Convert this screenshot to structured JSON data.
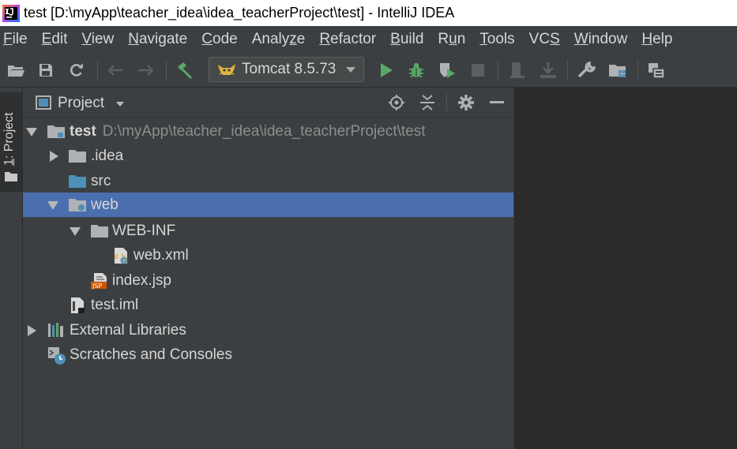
{
  "window": {
    "title": "test [D:\\myApp\\teacher_idea\\idea_teacherProject\\test] - IntelliJ IDEA"
  },
  "menu": [
    {
      "m": "F",
      "rest": "ile"
    },
    {
      "m": "E",
      "rest": "dit"
    },
    {
      "m": "V",
      "rest": "iew"
    },
    {
      "m": "N",
      "rest": "avigate"
    },
    {
      "m": "C",
      "rest": "ode"
    },
    {
      "pre": "Analy",
      "m": "z",
      "rest": "e"
    },
    {
      "m": "R",
      "rest": "efactor"
    },
    {
      "m": "B",
      "rest": "uild"
    },
    {
      "pre": "R",
      "m": "u",
      "rest": "n"
    },
    {
      "m": "T",
      "rest": "ools"
    },
    {
      "pre": "VC",
      "m": "S",
      "rest": ""
    },
    {
      "m": "W",
      "rest": "indow"
    },
    {
      "m": "H",
      "rest": "elp"
    }
  ],
  "toolbar": {
    "run_config": "Tomcat 8.5.73"
  },
  "side_tab": {
    "num": "1",
    "rest": ": Project"
  },
  "panel": {
    "title": "Project"
  },
  "tree": {
    "root_name": "test",
    "root_path": "D:\\myApp\\teacher_idea\\idea_teacherProject\\test",
    "idea": ".idea",
    "src": "src",
    "web": "web",
    "webinf": "WEB-INF",
    "webxml": "web.xml",
    "indexjsp": "index.jsp",
    "testiml": "test.iml",
    "extlibs": "External Libraries",
    "scratches": "Scratches and Consoles"
  },
  "colors": {
    "selection": "#4b6eaf",
    "folder_blue": "#4e8fb8",
    "run_green": "#59a869",
    "tomcat": "#e3b341"
  }
}
